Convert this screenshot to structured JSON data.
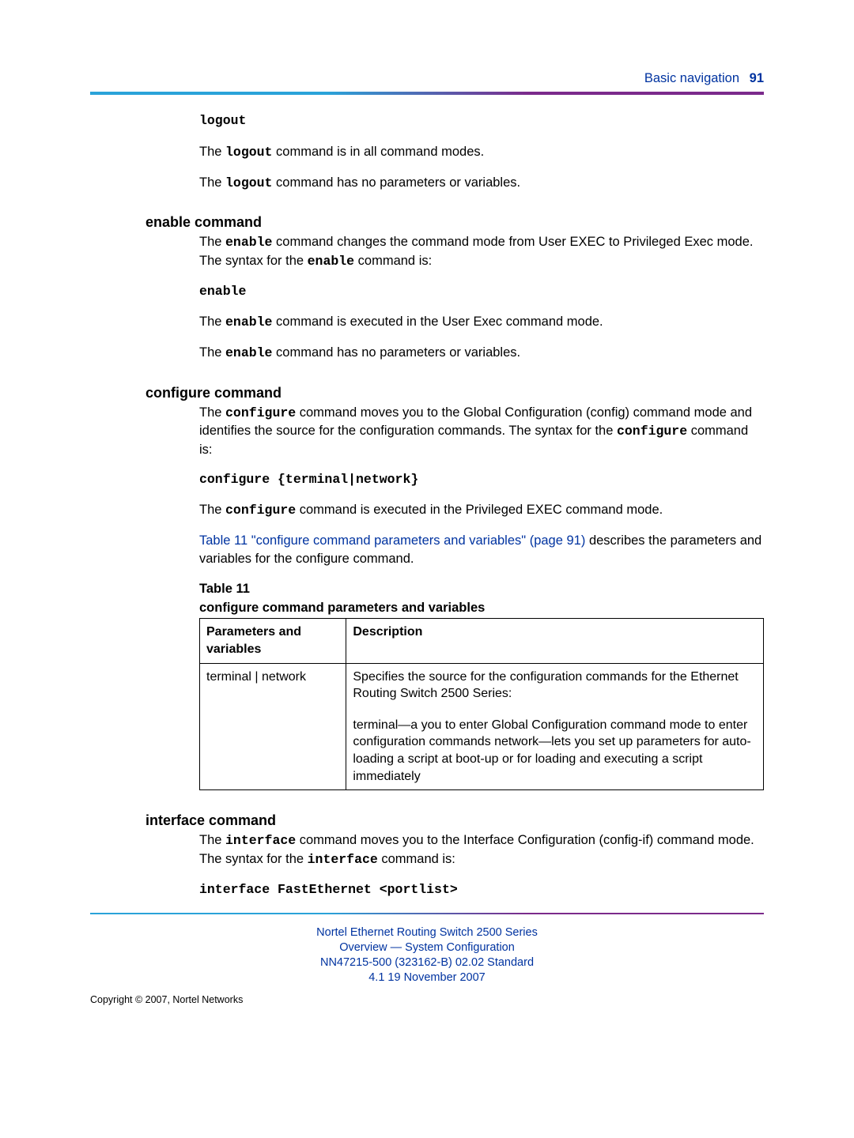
{
  "header": {
    "section": "Basic navigation",
    "page": "91"
  },
  "logout": {
    "cmd": "logout",
    "p1_a": "The ",
    "p1_b": "logout",
    "p1_c": " command is in all command modes.",
    "p2_a": "The ",
    "p2_b": "logout",
    "p2_c": " command has no parameters or variables."
  },
  "enable": {
    "heading": "enable command",
    "p1_a": "The ",
    "p1_b": "enable",
    "p1_c": " command changes the command mode from User EXEC to Privileged Exec mode. The syntax for the ",
    "p1_d": "enable",
    "p1_e": " command is:",
    "cmd": "enable",
    "p2_a": "The ",
    "p2_b": "enable",
    "p2_c": " command is executed in the User Exec command mode.",
    "p3_a": "The ",
    "p3_b": "enable",
    "p3_c": " command has no parameters or variables."
  },
  "configure": {
    "heading": "configure command",
    "p1_a": "The ",
    "p1_b": "configure",
    "p1_c": " command moves you to the Global Configuration (config) command mode and identifies the source for the configuration commands. The syntax for the ",
    "p1_d": "configure",
    "p1_e": " command is:",
    "cmd": "configure {terminal|network}",
    "p2_a": "The ",
    "p2_b": "configure",
    "p2_c": " command is executed in the Privileged EXEC command mode.",
    "link": "Table 11 \"configure command parameters and variables\" (page 91)",
    "p3_rest": " describes the parameters and variables for the configure command.",
    "table_caption": "Table 11",
    "table_title": "configure command parameters and variables",
    "th1": "Parameters and variables",
    "th2": "Description",
    "row1_c1": "terminal | network",
    "row1_c2a": "Specifies the source for the configuration commands for the Ethernet Routing Switch 2500 Series:",
    "row1_c2b": "terminal—a you to enter Global Configuration command mode to enter configuration commands network—lets you set up parameters for auto-loading a script at boot-up or for loading and executing a script immediately"
  },
  "interface": {
    "heading": "interface command",
    "p1_a": "The ",
    "p1_b": "interface",
    "p1_c": " command moves you to the Interface Configuration (config-if) command mode. The syntax for the ",
    "p1_d": "interface",
    "p1_e": " command is:",
    "cmd": "interface FastEthernet <portlist>"
  },
  "footer": {
    "l1": "Nortel Ethernet Routing Switch 2500 Series",
    "l2": "Overview — System Configuration",
    "l3": "NN47215-500 (323162-B)   02.02   Standard",
    "l4": "4.1   19 November 2007",
    "copyright": "Copyright © 2007, Nortel Networks"
  }
}
